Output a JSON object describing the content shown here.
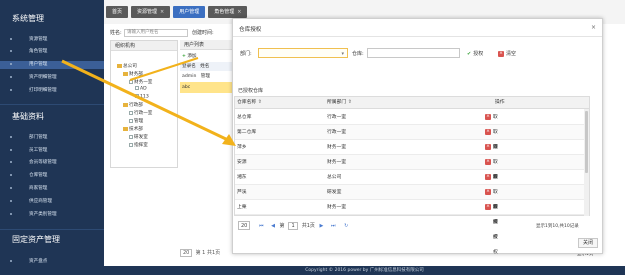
{
  "colors": {
    "sidebar": "#1f3555",
    "active_tab": "#3b6fc1",
    "arrow": "#f2b21b",
    "cancel_icon": "#d9534f"
  },
  "sidebar": {
    "sections": [
      {
        "title": "系统管理",
        "items": [
          "资源管理",
          "角色管理",
          "用户管理",
          "资产明细管理",
          "打印明细管理"
        ]
      },
      {
        "title": "基础资料",
        "items": [
          "部门管理",
          "员工管理",
          "会员等级管理",
          "仓库管理",
          "商家管理",
          "供应商管理",
          "资产类别管理"
        ]
      },
      {
        "title": "固定资产管理",
        "items": [
          "资产盘点"
        ]
      }
    ],
    "active_item": "用户管理"
  },
  "tabs": [
    {
      "label": "首页",
      "close": ""
    },
    {
      "label": "资源管理",
      "close": "×"
    },
    {
      "label": "用户管理",
      "close": ""
    },
    {
      "label": "角色管理",
      "close": "×"
    }
  ],
  "bg": {
    "name_label": "姓名:",
    "name_placeholder": "请输入用户姓名",
    "create_time_label": "创建时间:",
    "org_header": "组织机构",
    "org_tree": [
      "总公司",
      "财务部",
      "财务一室",
      "AD",
      "113",
      "行政部",
      "行政一室",
      "管理",
      "技术部",
      "研发室",
      "指挥室"
    ],
    "user_header": "用户列表",
    "add_label": "添加",
    "login_col": "登录名",
    "name_col": "姓名",
    "rows": [
      {
        "login": "admin",
        "name": "管理"
      },
      {
        "login": "abc",
        "name": ""
      }
    ],
    "pager_size": "20",
    "pager_page_label": "第",
    "pager_page": "1",
    "pager_total": "共1页",
    "status_right": "显示1到",
    "footer": "Copyright © 2016 power by 广州标准信息科技有限公司"
  },
  "modal": {
    "title": "仓库授权",
    "close_icon": "×",
    "dept_label": "部门:",
    "dept_caret": "▾",
    "warehouse_label": "仓库:",
    "grant_button": "授权",
    "clear_button": "清空",
    "clear_icon": "×",
    "section_title": "已授权仓库",
    "columns": [
      "仓库名称 ⇧",
      "所属部门 ⇧",
      "操作"
    ],
    "rows": [
      {
        "warehouse": "总仓库",
        "dept": "行政一室",
        "action": "取消授权"
      },
      {
        "warehouse": "第二仓库",
        "dept": "行政一室",
        "action": "取消授权"
      },
      {
        "warehouse": "萍乡",
        "dept": "财务一室",
        "action": "取消授权"
      },
      {
        "warehouse": "安源",
        "dept": "财务一室",
        "action": "取消授权"
      },
      {
        "warehouse": "湘东",
        "dept": "总公司",
        "action": "取消授权"
      },
      {
        "warehouse": "芦溪",
        "dept": "研发室",
        "action": "取消授权"
      },
      {
        "warehouse": "上栗",
        "dept": "财务一室",
        "action": "取消授权"
      }
    ],
    "pager": {
      "page_size": "20",
      "first": "⏮",
      "prev": "◀",
      "page_prefix": "第",
      "page": "1",
      "page_total": "共1页",
      "next": "▶",
      "last": "⏭",
      "refresh": "↻",
      "status": "显示1到10,共10记录"
    },
    "close_button": "关闭"
  }
}
